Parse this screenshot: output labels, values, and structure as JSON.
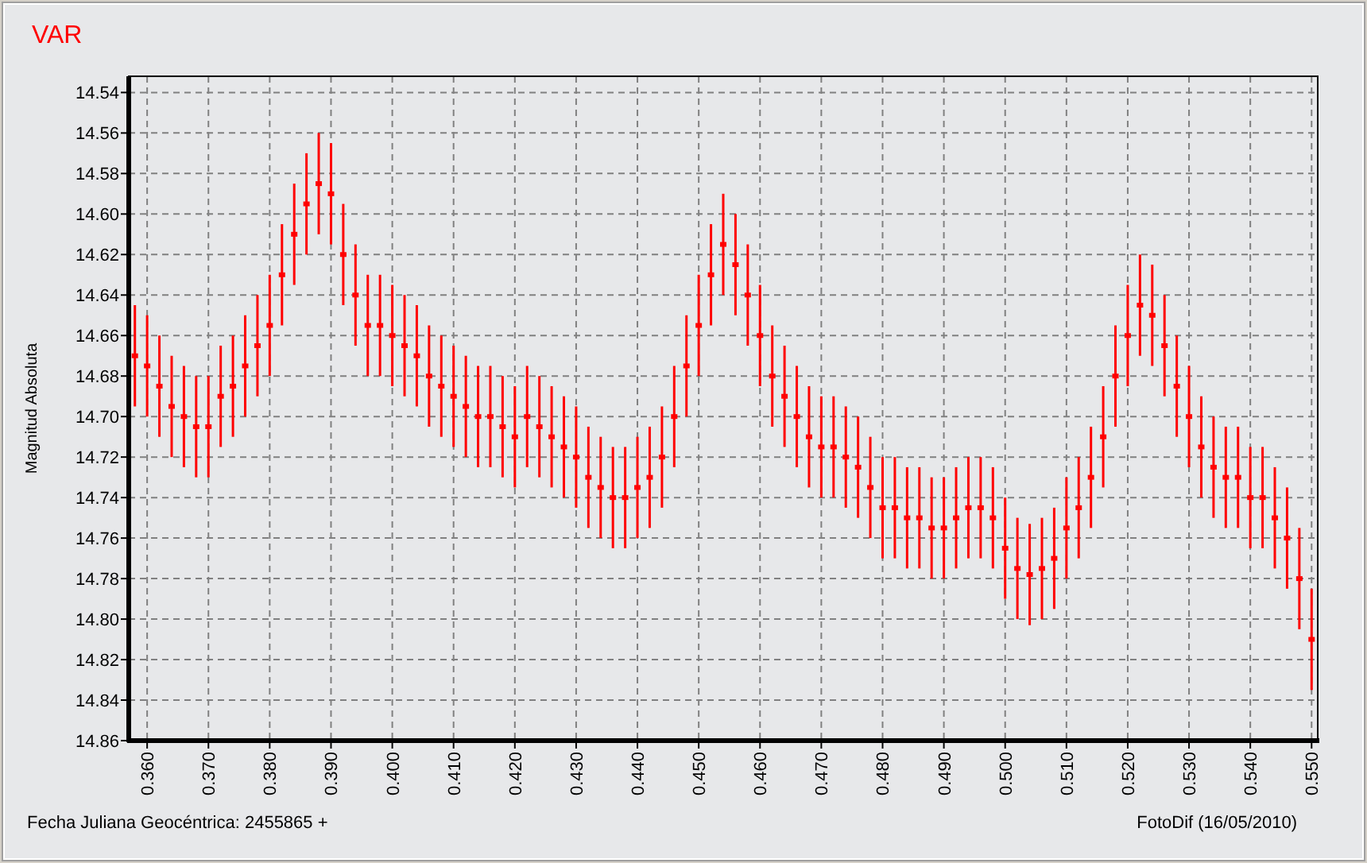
{
  "chart": {
    "chart_data": {
      "type": "scatter",
      "title": "VAR",
      "xlabel": "Fecha Juliana Geocéntrica: 2455865 +",
      "ylabel": "Magnitud Absoluta",
      "x": [
        0.358,
        0.36,
        0.362,
        0.364,
        0.366,
        0.368,
        0.37,
        0.372,
        0.374,
        0.376,
        0.378,
        0.38,
        0.382,
        0.384,
        0.386,
        0.388,
        0.39,
        0.392,
        0.394,
        0.396,
        0.398,
        0.4,
        0.402,
        0.404,
        0.406,
        0.408,
        0.41,
        0.412,
        0.414,
        0.416,
        0.418,
        0.42,
        0.422,
        0.424,
        0.426,
        0.428,
        0.43,
        0.432,
        0.434,
        0.436,
        0.438,
        0.44,
        0.442,
        0.444,
        0.446,
        0.448,
        0.45,
        0.452,
        0.454,
        0.456,
        0.458,
        0.46,
        0.462,
        0.464,
        0.466,
        0.468,
        0.47,
        0.472,
        0.474,
        0.476,
        0.478,
        0.48,
        0.482,
        0.484,
        0.486,
        0.488,
        0.49,
        0.492,
        0.494,
        0.496,
        0.498,
        0.5,
        0.502,
        0.504,
        0.506,
        0.508,
        0.51,
        0.512,
        0.514,
        0.516,
        0.518,
        0.52,
        0.522,
        0.524,
        0.526,
        0.528,
        0.53,
        0.532,
        0.534,
        0.536,
        0.538,
        0.54,
        0.542,
        0.544,
        0.546,
        0.548,
        0.55
      ],
      "series": [
        {
          "color": "#ff0000",
          "errors": [
            0.025,
            0.025,
            0.025,
            0.025,
            0.025,
            0.025,
            0.025,
            0.025,
            0.025,
            0.025,
            0.025,
            0.025,
            0.025,
            0.025,
            0.025,
            0.025,
            0.025,
            0.025,
            0.025,
            0.025,
            0.025,
            0.025,
            0.025,
            0.025,
            0.025,
            0.025,
            0.025,
            0.025,
            0.025,
            0.025,
            0.025,
            0.025,
            0.025,
            0.025,
            0.025,
            0.025,
            0.025,
            0.025,
            0.025,
            0.025,
            0.025,
            0.025,
            0.025,
            0.025,
            0.025,
            0.025,
            0.025,
            0.025,
            0.025,
            0.025,
            0.025,
            0.025,
            0.025,
            0.025,
            0.025,
            0.025,
            0.025,
            0.025,
            0.025,
            0.025,
            0.025,
            0.025,
            0.025,
            0.025,
            0.025,
            0.025,
            0.025,
            0.025,
            0.025,
            0.025,
            0.025,
            0.025,
            0.025,
            0.025,
            0.025,
            0.025,
            0.025,
            0.025,
            0.025,
            0.025,
            0.025,
            0.025,
            0.025,
            0.025,
            0.025,
            0.025,
            0.025,
            0.025,
            0.025,
            0.025,
            0.025,
            0.025,
            0.025,
            0.025,
            0.025,
            0.025,
            0.025
          ],
          "values": [
            14.67,
            14.675,
            14.685,
            14.695,
            14.7,
            14.705,
            14.705,
            14.69,
            14.685,
            14.675,
            14.665,
            14.655,
            14.63,
            14.61,
            14.595,
            14.585,
            14.59,
            14.62,
            14.64,
            14.655,
            14.655,
            14.66,
            14.665,
            14.67,
            14.68,
            14.685,
            14.69,
            14.695,
            14.7,
            14.7,
            14.705,
            14.71,
            14.7,
            14.705,
            14.71,
            14.715,
            14.72,
            14.73,
            14.735,
            14.74,
            14.74,
            14.735,
            14.73,
            14.72,
            14.7,
            14.675,
            14.655,
            14.63,
            14.615,
            14.625,
            14.64,
            14.66,
            14.68,
            14.69,
            14.7,
            14.71,
            14.715,
            14.715,
            14.72,
            14.725,
            14.735,
            14.745,
            14.745,
            14.75,
            14.75,
            14.755,
            14.755,
            14.75,
            14.745,
            14.745,
            14.75,
            14.765,
            14.775,
            14.778,
            14.775,
            14.77,
            14.755,
            14.745,
            14.73,
            14.71,
            14.68,
            14.66,
            14.645,
            14.65,
            14.665,
            14.685,
            14.7,
            14.715,
            14.725,
            14.73,
            14.73,
            14.74,
            14.74,
            14.75,
            14.76,
            14.78,
            14.81
          ]
        }
      ],
      "grid": true,
      "xlim": [
        0.357,
        0.551
      ],
      "ylim": [
        14.86,
        14.532
      ],
      "xticks": [
        {
          "value": 0.36,
          "label": "0.360"
        },
        {
          "value": 0.37,
          "label": "0.370"
        },
        {
          "value": 0.38,
          "label": "0.380"
        },
        {
          "value": 0.39,
          "label": "0.390"
        },
        {
          "value": 0.4,
          "label": "0.400"
        },
        {
          "value": 0.41,
          "label": "0.410"
        },
        {
          "value": 0.42,
          "label": "0.420"
        },
        {
          "value": 0.43,
          "label": "0.430"
        },
        {
          "value": 0.44,
          "label": "0.440"
        },
        {
          "value": 0.45,
          "label": "0.450"
        },
        {
          "value": 0.46,
          "label": "0.460"
        },
        {
          "value": 0.47,
          "label": "0.470"
        },
        {
          "value": 0.48,
          "label": "0.480"
        },
        {
          "value": 0.49,
          "label": "0.490"
        },
        {
          "value": 0.5,
          "label": "0.500"
        },
        {
          "value": 0.51,
          "label": "0.510"
        },
        {
          "value": 0.52,
          "label": "0.520"
        },
        {
          "value": 0.53,
          "label": "0.530"
        },
        {
          "value": 0.54,
          "label": "0.540"
        },
        {
          "value": 0.55,
          "label": "0.550"
        }
      ],
      "yticks": [
        {
          "value": 14.54,
          "label": "14.54"
        },
        {
          "value": 14.56,
          "label": "14.56"
        },
        {
          "value": 14.58,
          "label": "14.58"
        },
        {
          "value": 14.6,
          "label": "14.60"
        },
        {
          "value": 14.62,
          "label": "14.62"
        },
        {
          "value": 14.64,
          "label": "14.64"
        },
        {
          "value": 14.66,
          "label": "14.66"
        },
        {
          "value": 14.68,
          "label": "14.68"
        },
        {
          "value": 14.7,
          "label": "14.70"
        },
        {
          "value": 14.72,
          "label": "14.72"
        },
        {
          "value": 14.74,
          "label": "14.74"
        },
        {
          "value": 14.76,
          "label": "14.76"
        },
        {
          "value": 14.78,
          "label": "14.78"
        },
        {
          "value": 14.8,
          "label": "14.80"
        },
        {
          "value": 14.82,
          "label": "14.82"
        },
        {
          "value": 14.84,
          "label": "14.84"
        },
        {
          "value": 14.86,
          "label": "14.86"
        }
      ]
    },
    "credit": "FotoDif (16/05/2010)"
  }
}
